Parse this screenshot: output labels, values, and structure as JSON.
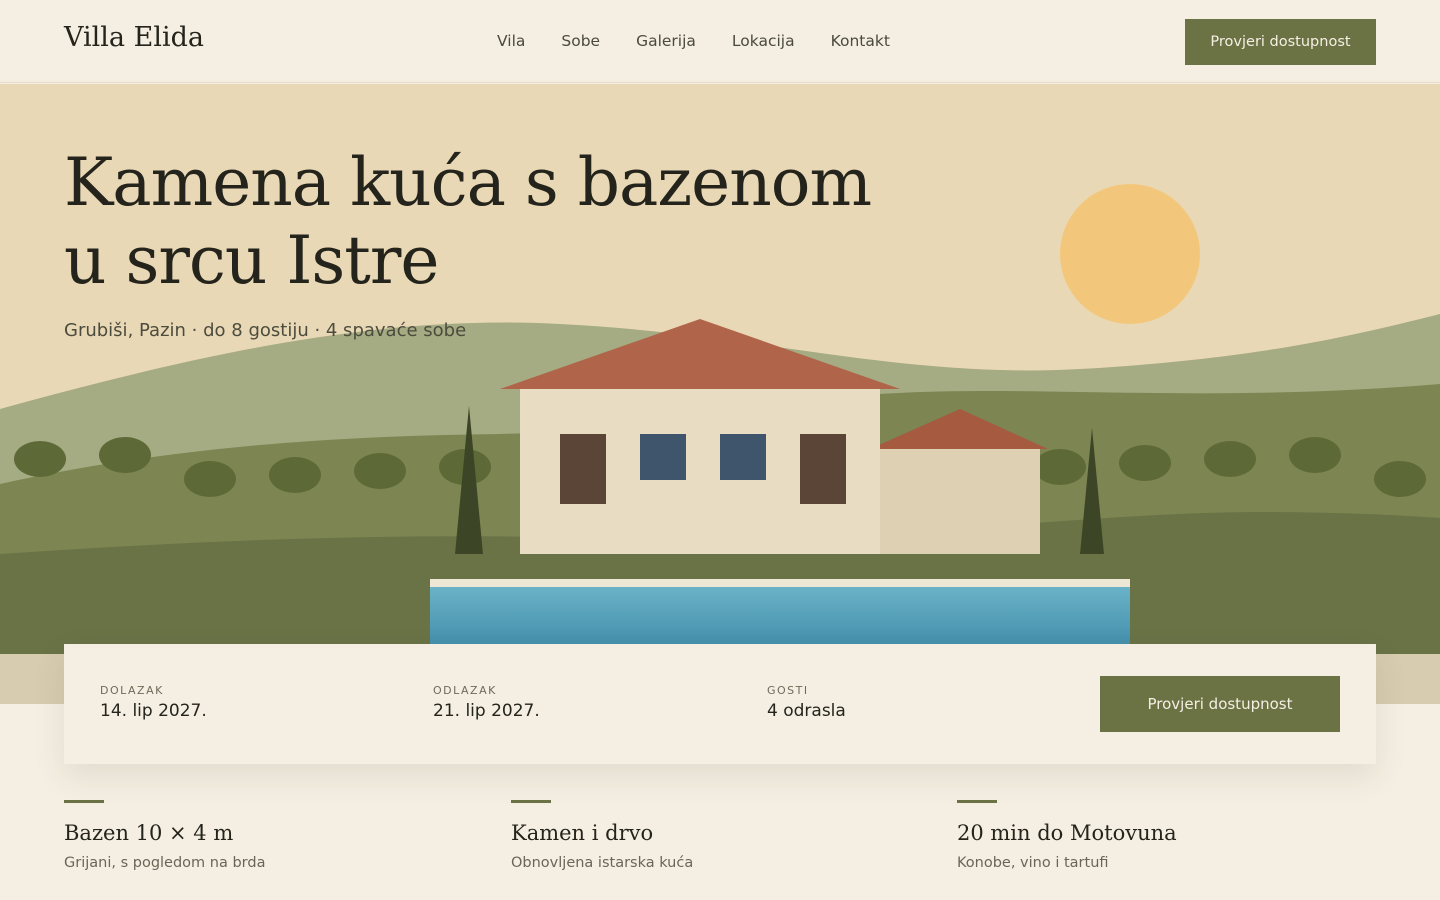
{
  "header": {
    "logo": "Villa Elida",
    "nav": [
      "Vila",
      "Sobe",
      "Galerija",
      "Lokacija",
      "Kontakt"
    ],
    "cta": "Provjeri dostupnost"
  },
  "hero": {
    "title": "Kamena kuća s bazenom u srcu Istre",
    "subtitle": "Grubiši, Pazin · do 8 gostiju · 4 spavaće sobe"
  },
  "booking": {
    "arrival_label": "DOLAZAK",
    "arrival_value": "14. lip 2027.",
    "departure_label": "ODLAZAK",
    "departure_value": "21. lip 2027.",
    "guests_label": "GOSTI",
    "guests_value": "4 odrasla",
    "cta": "Provjeri dostupnost"
  },
  "features": [
    {
      "title": "Bazen 10 × 4 m",
      "desc": "Grijani, s pogledom na brda"
    },
    {
      "title": "Kamen i drvo",
      "desc": "Obnovljena istarska kuća"
    },
    {
      "title": "20 min do Motovuna",
      "desc": "Konobe, vino i tartufi"
    }
  ],
  "colors": {
    "accent": "#6b7345",
    "background": "#f5efe3",
    "sky": "#e9d8b5",
    "sun": "#f3c77b",
    "roof": "#b0654a",
    "pool": "#5ba6bf"
  }
}
